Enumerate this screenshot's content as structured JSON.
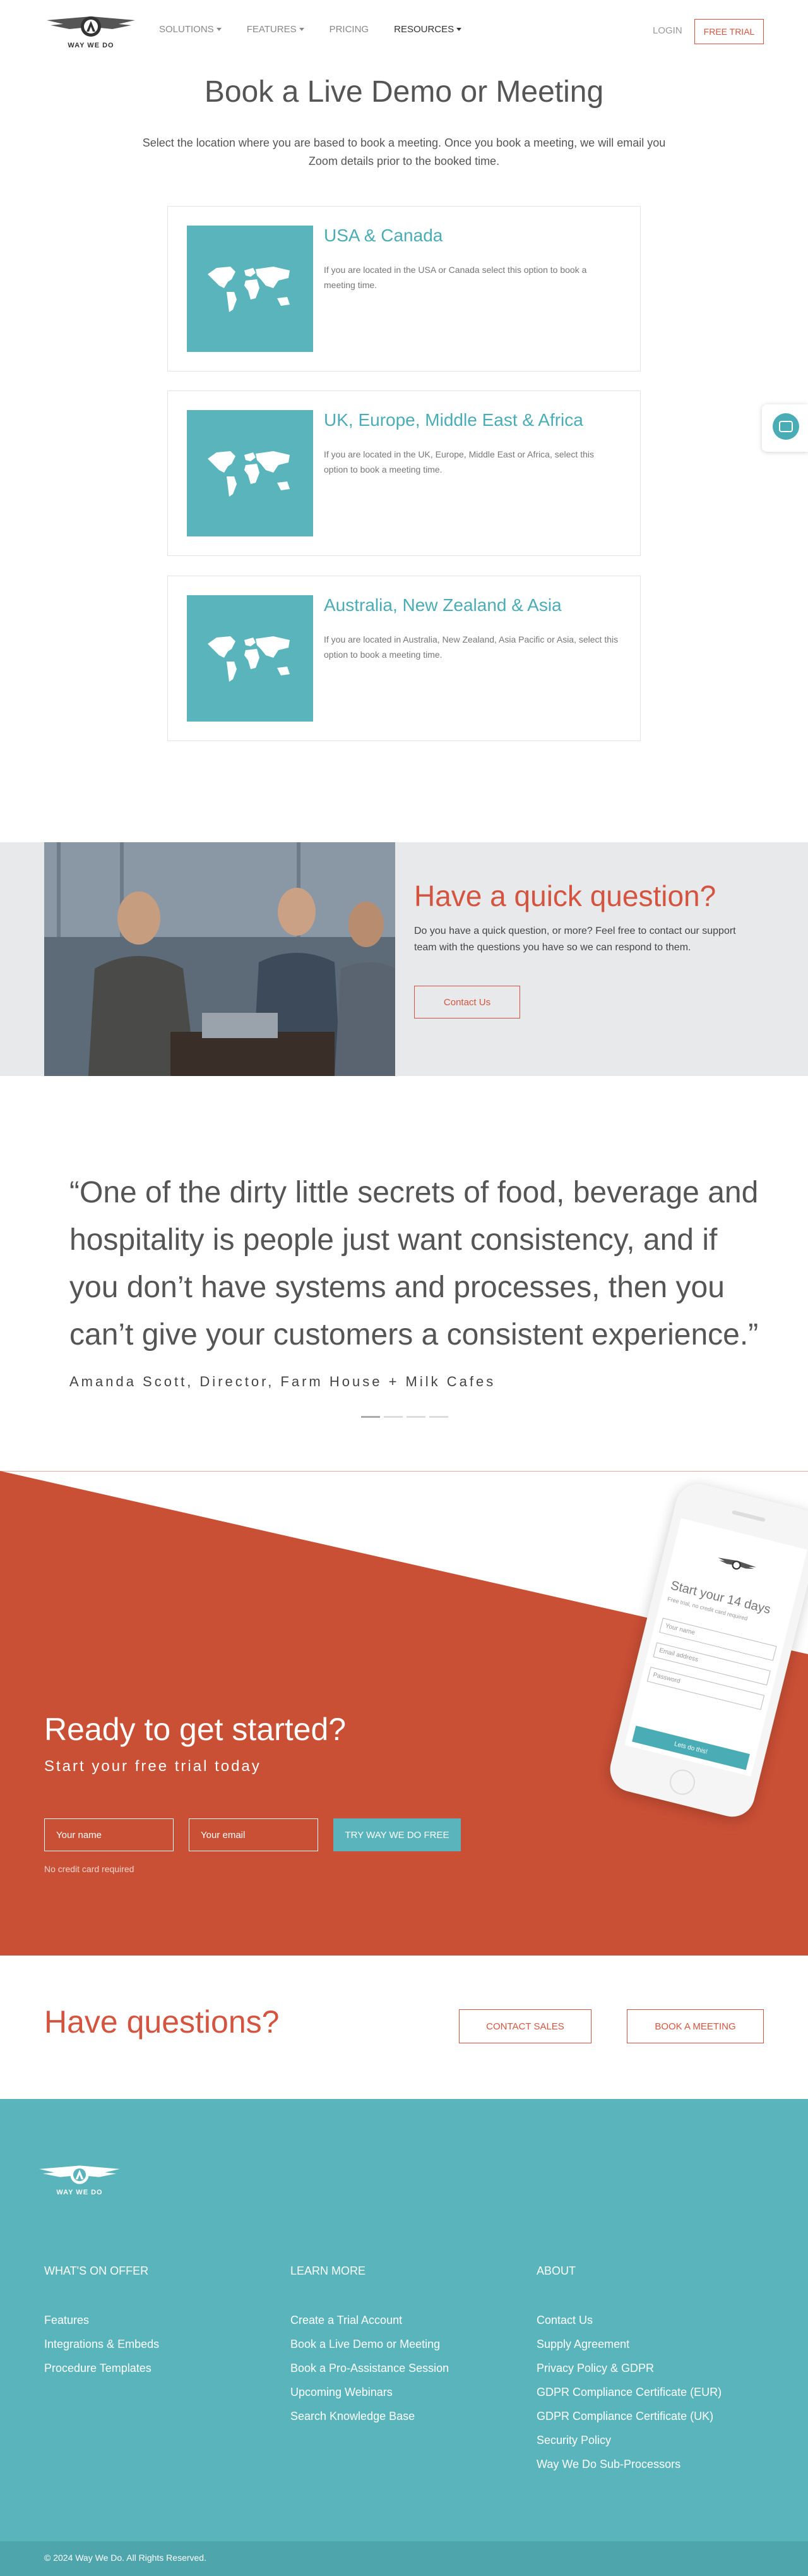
{
  "header": {
    "logo_text": "WAY WE DO",
    "nav": [
      {
        "label": "SOLUTIONS",
        "dropdown": true
      },
      {
        "label": "FEATURES",
        "dropdown": true
      },
      {
        "label": "PRICING",
        "dropdown": false
      },
      {
        "label": "RESOURCES",
        "dropdown": true
      }
    ],
    "login": "LOGIN",
    "free_trial": "FREE TRIAL"
  },
  "main": {
    "title": "Book a Live Demo or Meeting",
    "intro": "Select the location where you are based to book a meeting. Once you book a meeting, we will email you Zoom details prior to the booked time.",
    "locations": [
      {
        "title": "USA & Canada",
        "desc": "If you are located in the USA or Canada select this option to book a meeting time."
      },
      {
        "title": "UK, Europe, Middle East & Africa",
        "desc": "If you are located in the UK, Europe, Middle East or Africa, select this option to book a meeting time."
      },
      {
        "title": "Australia, New Zealand & Asia",
        "desc": "If you are located in Australia, New Zealand, Asia Pacific or Asia, select this option to book a meeting time."
      }
    ]
  },
  "quick_question": {
    "title": "Have a quick question?",
    "text": "Do you have a quick question, or more? Feel free to contact our support team with the questions you have so we can respond to them.",
    "button": "Contact Us"
  },
  "testimonial": {
    "quote": "“One of the dirty little secrets of food, beverage and hospitality is people just want consistency, and if you don’t have systems and processes, then you can’t give your customers a consistent experience.”",
    "author": "Amanda Scott, Director, Farm House + Milk Cafes"
  },
  "ready": {
    "title": "Ready to get started?",
    "subtitle": "Start your free trial today",
    "name_placeholder": "Your name",
    "email_placeholder": "Your email",
    "button": "TRY WAY WE DO FREE",
    "note": "No credit card required",
    "phone": {
      "title": "Start your 14 days",
      "sub": "Free trial, no credit card required",
      "field1": "Your name",
      "field2": "Email address",
      "field3": "Password",
      "button": "Lets do this!"
    }
  },
  "have_questions": {
    "title": "Have questions?",
    "contact_sales": "CONTACT SALES",
    "book_meeting": "BOOK A MEETING"
  },
  "footer": {
    "logo_text": "WAY WE DO",
    "offer": {
      "heading": "WHAT'S ON OFFER",
      "links": [
        "Features",
        "Integrations & Embeds",
        "Procedure Templates"
      ]
    },
    "learn": {
      "heading": "LEARN MORE",
      "links": [
        "Create a Trial Account",
        "Book a Live Demo or Meeting",
        "Book a Pro-Assistance Session",
        "Upcoming Webinars",
        "Search Knowledge Base"
      ]
    },
    "about": {
      "heading": "ABOUT",
      "links": [
        "Contact Us",
        "Supply Agreement",
        "Privacy Policy & GDPR",
        "GDPR Compliance Certificate (EUR)",
        "GDPR Compliance Certificate (UK)",
        "Security Policy",
        "Way We Do Sub-Processors"
      ]
    },
    "copyright": "© 2024 Way We Do. All Rights Reserved."
  },
  "colors": {
    "accent_red": "#d4543f",
    "teal": "#5ab4bb",
    "teal_text": "#4aadb6"
  }
}
